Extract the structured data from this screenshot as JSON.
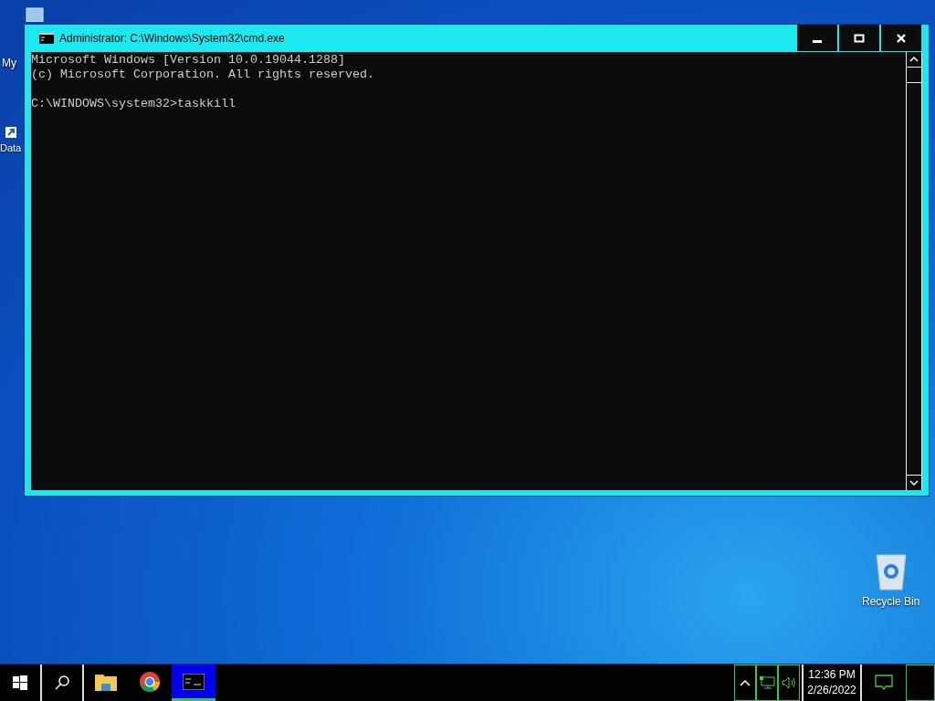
{
  "desktop_icons": [
    {
      "label": "My",
      "kind": "pc"
    },
    {
      "label": "Data",
      "kind": "shortcut"
    },
    {
      "label": "Recycle Bin",
      "kind": "bin"
    }
  ],
  "window": {
    "title": "Administrator: C:\\Windows\\System32\\cmd.exe",
    "banner": [
      "Microsoft Windows [Version 10.0.19044.1288]",
      "(c) Microsoft Corporation. All rights reserved."
    ],
    "prompt": "C:\\WINDOWS\\system32>taskkill"
  },
  "taskbar": {
    "apps": [
      {
        "kind": "explorer",
        "selected": false
      },
      {
        "kind": "chrome",
        "selected": false
      },
      {
        "kind": "cmd",
        "selected": true
      }
    ],
    "clock": {
      "time": "12:36 PM",
      "date": "2/26/2022"
    }
  }
}
